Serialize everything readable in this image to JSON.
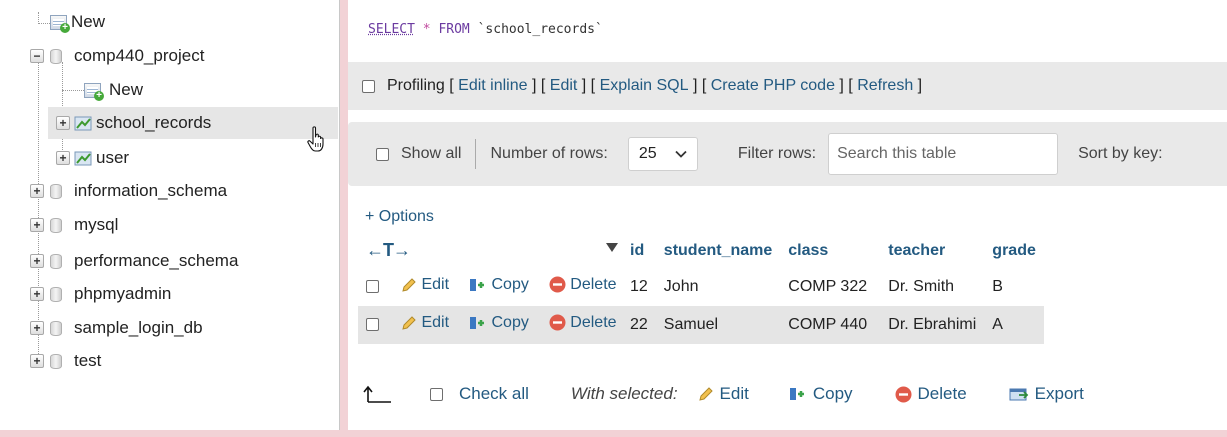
{
  "sidebar": {
    "items": [
      {
        "label": "New"
      },
      {
        "label": "comp440_project"
      },
      {
        "label": "New"
      },
      {
        "label": "school_records"
      },
      {
        "label": "user"
      },
      {
        "label": "information_schema"
      },
      {
        "label": "mysql"
      },
      {
        "label": "performance_schema"
      },
      {
        "label": "phpmyadmin"
      },
      {
        "label": "sample_login_db"
      },
      {
        "label": "test"
      }
    ],
    "expander_plus": "+",
    "expander_minus": "−"
  },
  "query": {
    "select": "SELECT",
    "star": "*",
    "from": "FROM",
    "table": "`school_records`"
  },
  "profiling": {
    "label": "Profiling",
    "links": [
      "Edit inline",
      "Edit",
      "Explain SQL",
      "Create PHP code",
      "Refresh"
    ]
  },
  "navigation": {
    "show_all": "Show all",
    "rows_label": "Number of rows:",
    "rows_value": "25",
    "filter_label": "Filter rows:",
    "search_placeholder": "Search this table",
    "sort_label": "Sort by key:"
  },
  "results": {
    "options_link": "+ Options",
    "arrows": "←T→",
    "columns": [
      "id",
      "student_name",
      "class",
      "teacher",
      "grade"
    ],
    "action_labels": {
      "edit": "Edit",
      "copy": "Copy",
      "delete": "Delete"
    },
    "rows": [
      {
        "id": "12",
        "student_name": "John",
        "class": "COMP 322",
        "teacher": "Dr. Smith",
        "grade": "B"
      },
      {
        "id": "22",
        "student_name": "Samuel",
        "class": "COMP 440",
        "teacher": "Dr. Ebrahimi",
        "grade": "A"
      }
    ]
  },
  "bulk": {
    "check_all": "Check all",
    "with_selected": "With selected:",
    "edit": "Edit",
    "copy": "Copy",
    "delete": "Delete",
    "export": "Export"
  },
  "colors": {
    "link": "#235a81",
    "frame_bg": "#f2d2d6",
    "bar_bg": "#e9e9e9",
    "row_alt": "#e5e5e5",
    "delete_red": "#e05a4a"
  }
}
